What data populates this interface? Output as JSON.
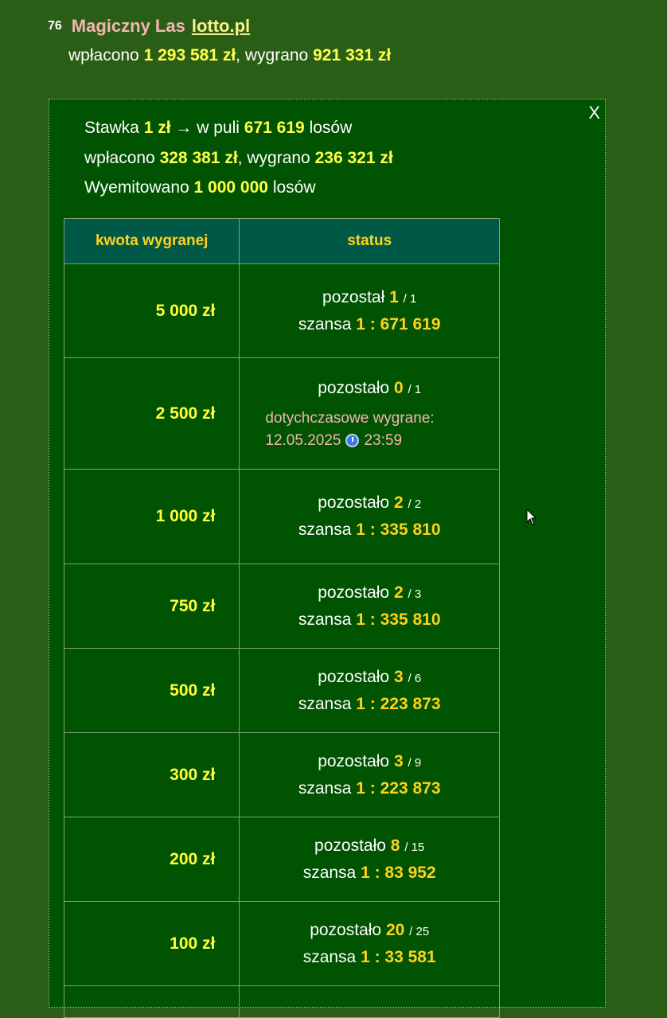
{
  "header": {
    "game_number": "76",
    "game_name": "Magiczny Las",
    "site_link": "lotto.pl",
    "paid_label": "wpłacono",
    "paid_value": "1 293 581 zł",
    "sep": ",",
    "won_label": "wygrano",
    "won_value": "921 331 zł"
  },
  "panel": {
    "close_label": "X",
    "stake_label": "Stawka",
    "stake_value": "1 zł",
    "pool_label": "→ w puli",
    "pool_value": "671 619",
    "pool_unit": "losów",
    "paid_label": "wpłacono",
    "paid_value": "328 381 zł",
    "won_label": "wygrano",
    "won_value": "236 321 zł",
    "issued_label": "Wyemitowano",
    "issued_value": "1 000 000",
    "issued_unit": "losów"
  },
  "table": {
    "headers": [
      "kwota wygranej",
      "status"
    ],
    "rows": [
      {
        "amount": "5 000 zł",
        "remaining_label": "pozostał",
        "remaining": "1",
        "total": "/ 1",
        "chance_label": "szansa",
        "chance": "1 : 671 619"
      },
      {
        "amount": "2 500 zł",
        "remaining_label": "pozostało",
        "remaining": "0",
        "total": "/ 1",
        "history_label": "dotychczasowe wygrane:",
        "history_date": "12.05.2025",
        "history_time": "23:59"
      },
      {
        "amount": "1 000 zł",
        "remaining_label": "pozostało",
        "remaining": "2",
        "total": "/ 2",
        "chance_label": "szansa",
        "chance": "1 : 335 810"
      },
      {
        "amount": "750 zł",
        "remaining_label": "pozostało",
        "remaining": "2",
        "total": "/ 3",
        "chance_label": "szansa",
        "chance": "1 : 335 810"
      },
      {
        "amount": "500 zł",
        "remaining_label": "pozostało",
        "remaining": "3",
        "total": "/ 6",
        "chance_label": "szansa",
        "chance": "1 : 223 873"
      },
      {
        "amount": "300 zł",
        "remaining_label": "pozostało",
        "remaining": "3",
        "total": "/ 9",
        "chance_label": "szansa",
        "chance": "1 : 223 873"
      },
      {
        "amount": "200 zł",
        "remaining_label": "pozostało",
        "remaining": "8",
        "total": "/ 15",
        "chance_label": "szansa",
        "chance": "1 : 83 952"
      },
      {
        "amount": "100 zł",
        "remaining_label": "pozostało",
        "remaining": "20",
        "total": "/ 25",
        "chance_label": "szansa",
        "chance": "1 : 33 581"
      }
    ]
  },
  "icons": {
    "history_time": "alarm-clock-icon",
    "cursor": "mouse-pointer-icon"
  }
}
